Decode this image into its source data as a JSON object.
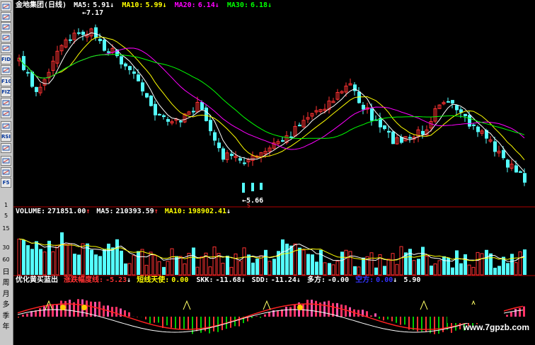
{
  "sidebar": {
    "icons": [
      "chart-icon",
      "zoom-icon",
      "line-icon",
      "kline-icon",
      "table-icon",
      "fid-icon",
      "report-icon",
      "f10-icon",
      "fiz-icon",
      "info-icon",
      "search-icon",
      "grid-icon",
      "rsi-icon",
      "nav-icon",
      "tool-icon",
      "alert-icon",
      "f5-icon"
    ],
    "icon_labels": [
      "",
      "",
      "",
      "",
      "",
      "FID",
      "",
      "F10",
      "FIZ",
      "",
      "",
      "",
      "RSI",
      "",
      "",
      "",
      "F5"
    ],
    "numbers": [
      "1",
      "5",
      "15",
      "30",
      "60"
    ],
    "periods": [
      "日",
      "周",
      "月",
      "多",
      "季",
      "年"
    ]
  },
  "main": {
    "name": "金地集团",
    "period": "(日线)",
    "ma5_label": "MA5:",
    "ma5": "5.91",
    "ma5_arrow": "↓",
    "ma10_label": "MA10:",
    "ma10": "5.99",
    "ma10_arrow": "↓",
    "ma20_label": "MA20:",
    "ma20": "6.14",
    "ma20_arrow": "↓",
    "ma30_label": "MA30:",
    "ma30": "6.18",
    "ma30_arrow": "↓",
    "high_label": "7.17",
    "low_label": "5.66"
  },
  "volume": {
    "label": "VOLUME:",
    "value": "271851.00",
    "arrow": "↑",
    "ma5_label": "MA5:",
    "ma5": "210393.59",
    "ma5_arrow": "↑",
    "ma10_label": "MA10:",
    "ma10": "198902.41",
    "ma10_arrow": "↓"
  },
  "indicator": {
    "name": "优化黄买蓝出",
    "l1": "涨跌幅度线:",
    "v1": "-5.23",
    "a1": "↓",
    "l2": "短线天使:",
    "v2": "0.00",
    "l3": "SKK:",
    "v3": "-11.68",
    "a3": "↓",
    "l4": "SDD:",
    "v4": "-11.24",
    "a4": "↓",
    "l5": "多方:",
    "v5": "-0.00",
    "l6": "空方:",
    "v6": "0.00",
    "a6": "↓",
    "v7": "5.90"
  },
  "watermark": "www.7gpzb.com",
  "colors": {
    "up": "#ff3232",
    "down": "#54ffff",
    "ma5": "#ffffff",
    "ma10": "#ffff00",
    "ma20": "#ff00ff",
    "ma30": "#00ff00",
    "axis": "#b00000"
  }
}
